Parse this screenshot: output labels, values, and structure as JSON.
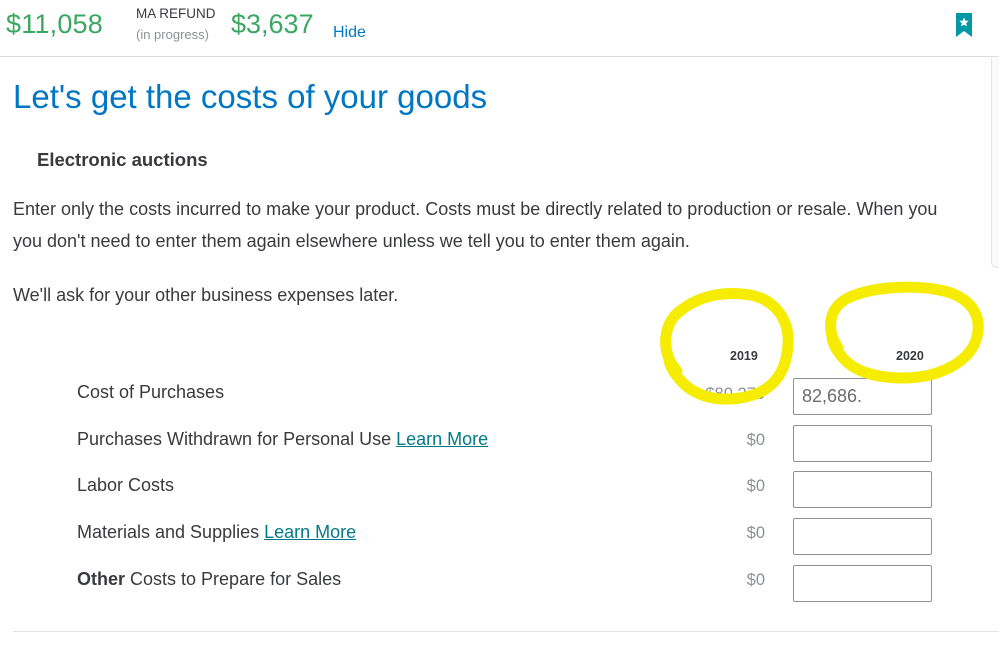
{
  "refund_bar": {
    "federal_amount": "$11,058",
    "state_label": "MA REFUND",
    "state_status": "(in progress)",
    "state_amount": "$3,637",
    "hide_label": "Hide",
    "bookmark_icon": "bookmark-star-icon"
  },
  "page": {
    "title": "Let's get the costs of your goods",
    "section": "Electronic auctions",
    "intro_line1": "Enter only the costs incurred to make your product. Costs must be directly related to production or resale. When you",
    "intro_line2": "you don't need to enter them again elsewhere unless we tell you to enter them again.",
    "later_note": "We'll ask for your other business expenses later."
  },
  "table": {
    "col_prior": "2019",
    "col_current": "2020",
    "rows": [
      {
        "label": "Cost of Purchases",
        "link": "",
        "prior": "$80,270",
        "current": "82,686."
      },
      {
        "label": "Purchases Withdrawn for Personal Use ",
        "link": "Learn More",
        "prior": "$0",
        "current": ""
      },
      {
        "label": "Labor Costs",
        "link": "",
        "prior": "$0",
        "current": ""
      },
      {
        "label": "Materials and Supplies ",
        "link": "Learn More",
        "prior": "$0",
        "current": ""
      },
      {
        "label_bold": "Other",
        "label": " Costs to Prepare for Sales",
        "link": "",
        "prior": "$0",
        "current": ""
      }
    ]
  },
  "colors": {
    "refund_green": "#3aa860",
    "title_blue": "#0077c5",
    "link_teal": "#007a86",
    "highlight_yellow": "#f5ec00"
  }
}
